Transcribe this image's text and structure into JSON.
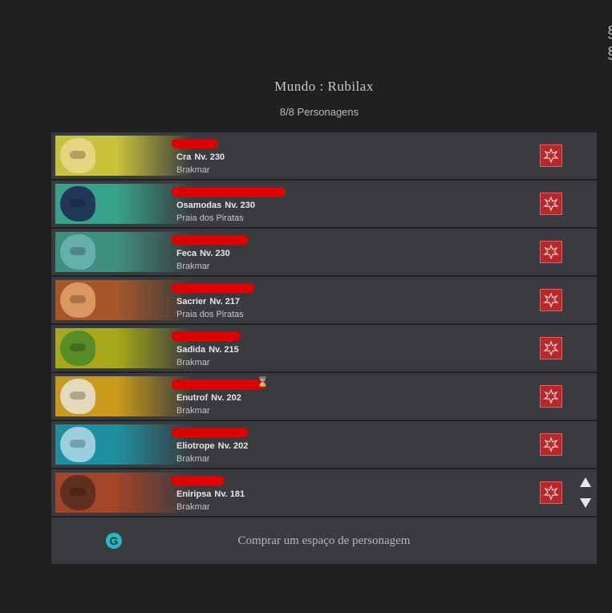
{
  "header": {
    "world_title": "Mundo : Rubilax",
    "char_count": "8/8 Personagens"
  },
  "characters": [
    {
      "name_visible": "",
      "class": "Cra",
      "level": "Nv. 230",
      "server": "Brakmar",
      "hourglass": false,
      "portrait_color": "#c8c23a",
      "face_color": "#e9d68a"
    },
    {
      "name_visible": "",
      "class": "Osamodas",
      "level": "Nv. 230",
      "server": "Praia dos Piratas",
      "hourglass": false,
      "portrait_color": "#37a38a",
      "face_color": "#1f2d55"
    },
    {
      "name_visible": "",
      "class": "Feca",
      "level": "Nv. 230",
      "server": "Brakmar",
      "hourglass": false,
      "portrait_color": "#3f8f7e",
      "face_color": "#6bb3b2"
    },
    {
      "name_visible": "",
      "class": "Sacrier",
      "level": "Nv. 217",
      "server": "Praia dos Piratas",
      "hourglass": false,
      "portrait_color": "#a6572a",
      "face_color": "#e0a066"
    },
    {
      "name_visible": "",
      "class": "Sadida",
      "level": "Nv. 215",
      "server": "Brakmar",
      "hourglass": false,
      "portrait_color": "#a7a91a",
      "face_color": "#4f8a2a"
    },
    {
      "name_visible": "",
      "class": "Enutrof",
      "level": "Nv. 202",
      "server": "Brakmar",
      "hourglass": true,
      "portrait_color": "#c99a1a",
      "face_color": "#e8dfcf"
    },
    {
      "name_visible": "",
      "class": "Eliotrope",
      "level": "Nv. 202",
      "server": "Brakmar",
      "hourglass": false,
      "portrait_color": "#1f8f9f",
      "face_color": "#a9d7e8"
    },
    {
      "name_visible": "",
      "class": "Eniripsa",
      "level": "Nv. 181",
      "server": "Brakmar",
      "hourglass": false,
      "portrait_color": "#a2452b",
      "face_color": "#5a2d20"
    }
  ],
  "redactions": [
    {
      "width": 58
    },
    {
      "width": 142
    },
    {
      "width": 96
    },
    {
      "width": 104
    },
    {
      "width": 86
    },
    {
      "width": 118
    },
    {
      "width": 96
    },
    {
      "width": 66
    }
  ],
  "buy_bar": {
    "label": "Comprar um espaço de personagem",
    "icon": "ogrine-icon",
    "icon_glyph": "G"
  },
  "colors": {
    "background": "#1f2022",
    "row_bg": "#3a3b3e",
    "alignment_red": "#b8282a",
    "ogrine_teal": "#2bb7c2"
  }
}
